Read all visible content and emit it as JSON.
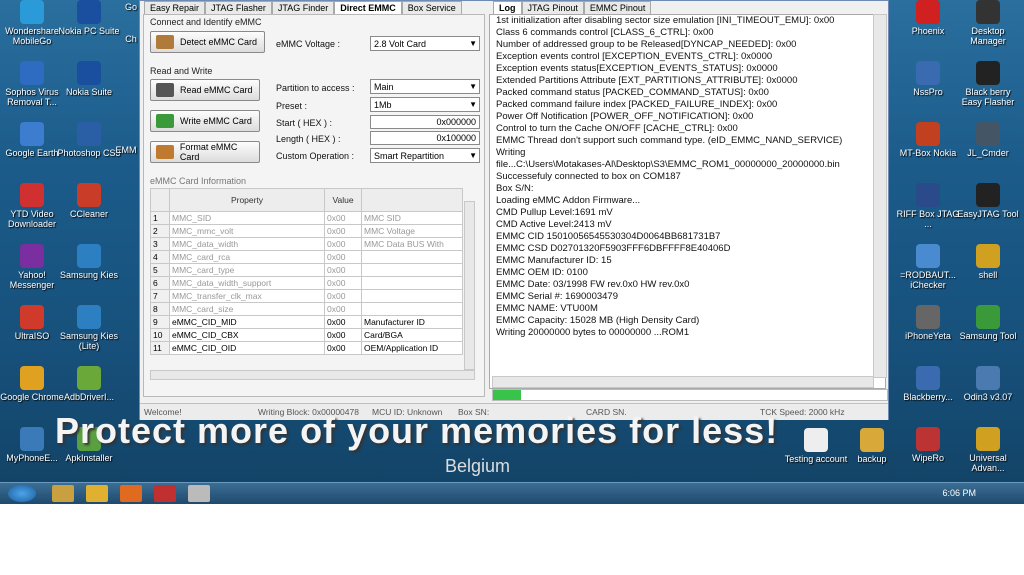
{
  "tabs_left": [
    "Easy Repair",
    "JTAG Flasher",
    "JTAG Finder",
    "Direct EMMC",
    "Box Service"
  ],
  "tabs_right": [
    "Log",
    "JTAG Pinout",
    "EMMC Pinout"
  ],
  "group_connect": "Connect and Identify eMMC",
  "identify_btn": "Detect eMMC Card",
  "voltage_label": "eMMC Voltage :",
  "voltage_value": "2.8 Volt Card",
  "group_rw": "Read and Write",
  "read_btn": "Read eMMC Card",
  "write_btn": "Write eMMC Card",
  "format_btn": "Format eMMC Card",
  "partition_label": "Partition to access :",
  "partition_value": "Main",
  "preset_label": "Preset :",
  "preset_value": "1Mb",
  "start_label": "Start ( HEX ) :",
  "start_value": "0x000000",
  "length_label": "Length ( HEX ) :",
  "length_value": "0x100000",
  "custom_label": "Custom Operation :",
  "custom_value": "Smart Repartition",
  "info_label": "eMMC Card Information",
  "table_headers": [
    "Property",
    "Value",
    ""
  ],
  "table_rows": [
    [
      "1",
      "MMC_SID",
      "0x00",
      "MMC SID"
    ],
    [
      "2",
      "MMC_mmc_volt",
      "0x00",
      "MMC Voltage"
    ],
    [
      "3",
      "MMC_data_width",
      "0x00",
      "MMC Data BUS With"
    ],
    [
      "4",
      "MMC_card_rca",
      "0x00",
      ""
    ],
    [
      "5",
      "MMC_card_type",
      "0x00",
      ""
    ],
    [
      "6",
      "MMC_data_width_support",
      "0x00",
      ""
    ],
    [
      "7",
      "MMC_transfer_clk_max",
      "0x00",
      ""
    ],
    [
      "8",
      "MMC_card_size",
      "0x00",
      ""
    ],
    [
      "9",
      "eMMC_CID_MID",
      "0x00",
      "Manufacturer ID"
    ],
    [
      "10",
      "eMMC_CID_CBX",
      "0x00",
      "Card/BGA"
    ],
    [
      "11",
      "eMMC_CID_OID",
      "0x00",
      "OEM/Application ID"
    ]
  ],
  "log_lines": [
    "1st initialization after disabling sector size emulation [INI_TIMEOUT_EMU]: 0x00",
    "Class 6 commands control [CLASS_6_CTRL]: 0x00",
    "Number of addressed group to be Released[DYNCAP_NEEDED]: 0x00",
    "Exception events control [EXCEPTION_EVENTS_CTRL]: 0x0000",
    "Exception events status[EXCEPTION_EVENTS_STATUS]: 0x0000",
    "Extended Partitions Attribute [EXT_PARTITIONS_ATTRIBUTE]: 0x0000",
    "Packed command status [PACKED_COMMAND_STATUS]: 0x00",
    "Packed command failure index [PACKED_FAILURE_INDEX]: 0x00",
    "Power Off Notification [POWER_OFF_NOTIFICATION]: 0x00",
    "Control to turn the Cache ON/OFF [CACHE_CTRL]: 0x00",
    "EMMC Thread don't support such command type. (eID_EMMC_NAND_SERVICE)",
    "Writing",
    "file...C:\\Users\\Motakases-Al\\Desktop\\S3\\EMMC_ROM1_00000000_20000000.bin",
    "Successefuly connected to box on COM187",
    "Box S/N:",
    "Loading eMMC Addon Firmware...",
    "CMD Pullup Level:1691 mV",
    "CMD Active Level:2413 mV",
    "EMMC CID 15010056545530304D0064BB681731B7",
    "EMMC CSD D02701320F5903FFF6DBFFFF8E40406D",
    "EMMC Manufacturer ID: 15",
    "EMMC OEM ID: 0100",
    "EMMC Date: 03/1998 FW rev.0x0 HW rev.0x0",
    "EMMC Serial #: 1690003479",
    "EMMC NAME: VTU00M",
    "EMMC Capacity: 15028 MB (High Density Card)",
    "Writing 20000000 bytes to 00000000 ...ROM1"
  ],
  "status": {
    "welcome": "Welcome!",
    "writing": "Writing Block: 0x00000478",
    "mcu": "MCU ID: Unknown",
    "box": "Box SN:",
    "card": "CARD SN.",
    "tck": "TCK Speed: 2000 kHz"
  },
  "desktop_left": [
    {
      "label": "Wondershare MobileGo",
      "color": "#2a9bd8"
    },
    {
      "label": "Nokia PC Suite",
      "color": "#1a4fa0"
    },
    {
      "label": "Sophos Virus Removal T...",
      "color": "#2d6cc0"
    },
    {
      "label": "Nokia Suite",
      "color": "#1a4fa0"
    },
    {
      "label": "Google Earth",
      "color": "#3c7dd0"
    },
    {
      "label": "Photoshop CS3",
      "color": "#2a5fa5"
    },
    {
      "label": "YTD Video Downloader",
      "color": "#d03030"
    },
    {
      "label": "CCleaner",
      "color": "#c83c28"
    },
    {
      "label": "Yahoo! Messenger",
      "color": "#7a2ea0"
    },
    {
      "label": "Samsung Kies",
      "color": "#2c7fc0"
    },
    {
      "label": "UltraISO",
      "color": "#d03a2a"
    },
    {
      "label": "Samsung Kies (Lite)",
      "color": "#2c7fc0"
    },
    {
      "label": "Google Chrome",
      "color": "#e0a020"
    },
    {
      "label": "AdbDriverI...",
      "color": "#6aa83a"
    },
    {
      "label": "MyPhoneE...",
      "color": "#3a7ab8"
    },
    {
      "label": "ApkInstaller",
      "color": "#5aa040"
    }
  ],
  "desktop_right": [
    {
      "label": "Phoenix",
      "color": "#d02020"
    },
    {
      "label": "Desktop Manager",
      "color": "#333333"
    },
    {
      "label": "NssPro",
      "color": "#3a6ab0"
    },
    {
      "label": "Black berry Easy Flasher",
      "color": "#222222"
    },
    {
      "label": "MT-Box Nokia",
      "color": "#c04020"
    },
    {
      "label": "JL_Cmder",
      "color": "#445566"
    },
    {
      "label": "RIFF Box JTAG ...",
      "color": "#2a4a8a"
    },
    {
      "label": "EasyJTAG Tool",
      "color": "#222222"
    },
    {
      "label": "=RODBAUT... iChecker",
      "color": "#4a8ad0"
    },
    {
      "label": "shell",
      "color": "#d0a020"
    },
    {
      "label": "iPhoneYeta",
      "color": "#666666"
    },
    {
      "label": "Samsung Tool",
      "color": "#3a9a3a"
    },
    {
      "label": "Blackberry...",
      "color": "#3a6ab0"
    },
    {
      "label": "Odin3 v3.07",
      "color": "#4a7ab0"
    },
    {
      "label": "WipeRo",
      "color": "#bb3333"
    },
    {
      "label": "Universal Advan...",
      "color": "#d0a020"
    }
  ],
  "desktop_mid": [
    {
      "label": "Testing account",
      "color": "#eeeeee"
    },
    {
      "label": "backup",
      "color": "#d8a838"
    }
  ],
  "partial_icons": [
    "Go",
    "Ch",
    "EMM"
  ],
  "watermark": "Protect more of your memories for less!",
  "watermark2": "Belgium",
  "clock": "6:06 PM"
}
